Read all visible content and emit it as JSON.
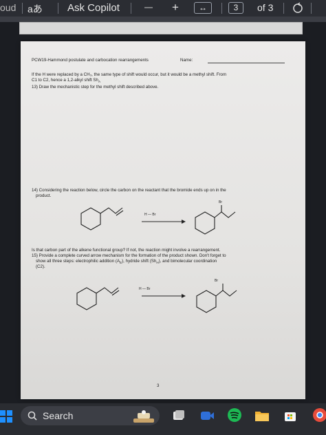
{
  "toolbar": {
    "left_fragment": "oud",
    "aa_label": "aあ",
    "ask_copilot": "Ask Copilot",
    "zoom_out": "—",
    "zoom_in": "+",
    "fit_symbol": "↔",
    "page_current": "3",
    "page_of": "of 3"
  },
  "document": {
    "header": "PCW19-Hammond postulate and carbocation rearrangements",
    "name_label": "Name:",
    "para_line1": "If the H were replaced by a CH₃, the same type of shift would occur, but it would be a methyl shift. From",
    "para_line2": "C1 to C2, hence a 1,2-alkyl shift Sh",
    "para_sub": "A",
    "q13": "13) Draw the mechanistic step for the methyl shift described above.",
    "q14_line1": "14) Considering the reaction below, circle the carbon on the reactant that the bromide ends up on in the",
    "q14_line2": "product.",
    "reagent_label": "H — Br",
    "br_label": "Br",
    "is_that": "Is that carbon part of the alkene functional group? If not, the reaction might involve a rearrangement.",
    "q15_line1": "15) Provide a complete curved arrow mechanism for the formation of the product shown. Don't forget to",
    "q15_line2": "show all three steps: electrophilic addition (A",
    "q15_line2_sub": "E",
    "q15_line2_b": "), hydride shift (Sh",
    "q15_line2_sub2": "H",
    "q15_line2_c": "), and bimolecular coordination",
    "q15_line3": "(C2).",
    "page_number": "3"
  },
  "taskbar": {
    "search_label": "Search",
    "colors": {
      "windows": "#1e90ff",
      "spotify": "#1db954",
      "meet": "#2f6fd8",
      "folder": "#f2b233",
      "store": "#f5f5f5",
      "chrome": "#e74c3c"
    }
  }
}
